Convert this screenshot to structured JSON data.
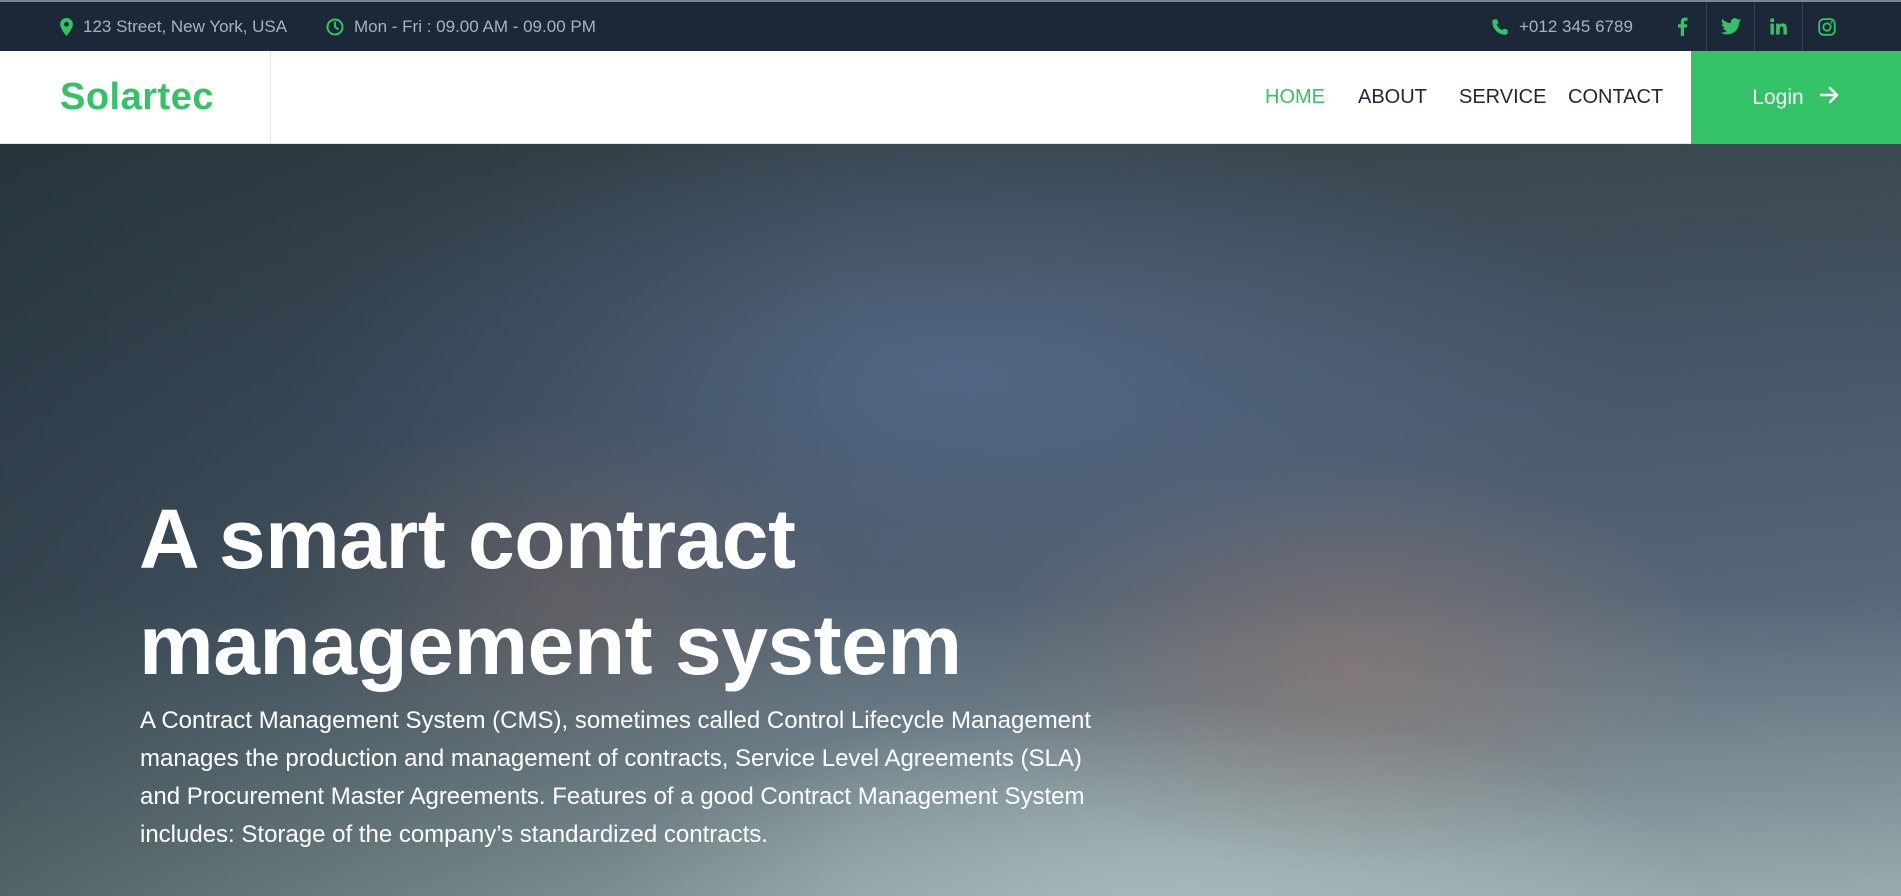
{
  "topbar": {
    "address": "123 Street, New York, USA",
    "hours": "Mon - Fri : 09.00 AM - 09.00 PM",
    "phone": "+012 345 6789",
    "social_icons": [
      "facebook-icon",
      "twitter-icon",
      "linkedin-icon",
      "instagram-icon"
    ]
  },
  "navbar": {
    "brand": "Solartec",
    "links": [
      "HOME",
      "ABOUT",
      "SERVICE",
      "CONTACT"
    ],
    "active_link": "HOME",
    "login_label": "Login"
  },
  "hero": {
    "title_line1": "A smart contract",
    "title_line2": "management system",
    "description_lines": [
      "A Contract Management System (CMS), sometimes called Control Lifecycle Management",
      "manages the production and management of contracts, Service Level Agreements (SLA)",
      "and Procurement Master Agreements. Features of a good Contract Management System",
      "includes: Storage of the company’s standardized contracts."
    ]
  },
  "colors": {
    "accent": "#33c266",
    "topbar_bg": "#1c2838",
    "nav_text": "#1c2838"
  }
}
